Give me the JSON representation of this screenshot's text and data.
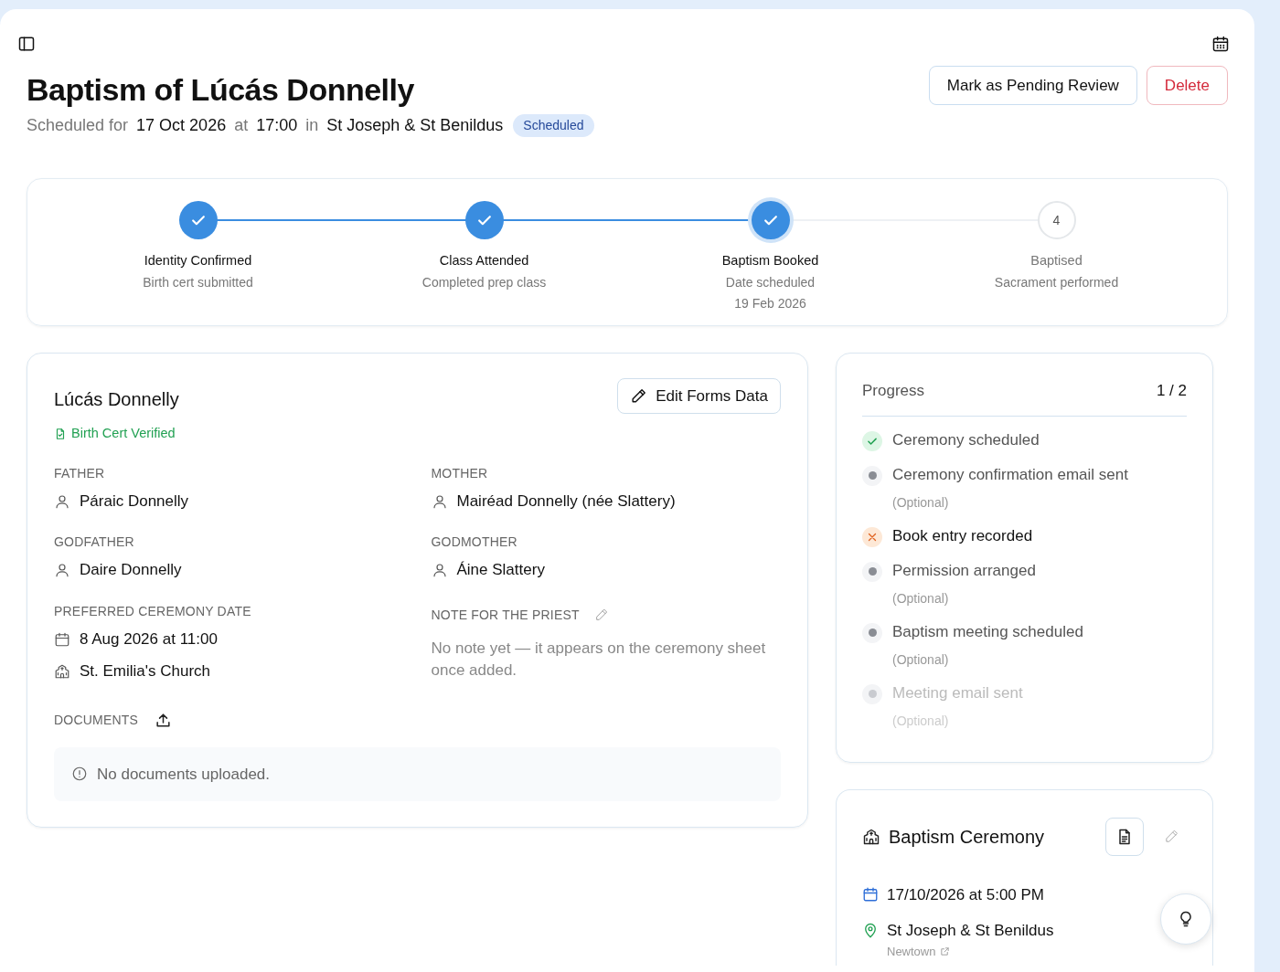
{
  "header": {
    "title": "Baptism of Lúcás Donnelly",
    "subtitle": [
      {
        "text": "Scheduled for",
        "emphasis": false
      },
      {
        "text": "17 Oct 2026",
        "emphasis": true
      },
      {
        "text": "at",
        "emphasis": false
      },
      {
        "text": "17:00",
        "emphasis": true
      },
      {
        "text": "in",
        "emphasis": false
      },
      {
        "text": "St Joseph & St Benildus",
        "emphasis": true
      }
    ],
    "status_badge": "Scheduled"
  },
  "actions": [
    {
      "label": "Mark as Pending Review",
      "kind": "neutral"
    },
    {
      "label": "Delete",
      "kind": "danger"
    }
  ],
  "stepper": [
    {
      "title": "Identity Confirmed",
      "lines": [
        "Birth cert submitted"
      ],
      "kind": "done",
      "current": false
    },
    {
      "title": "Class Attended",
      "lines": [
        "Completed prep class"
      ],
      "kind": "done",
      "current": false
    },
    {
      "title": "Baptism Booked",
      "lines": [
        "Date scheduled",
        "19 Feb 2026"
      ],
      "kind": "done",
      "current": true
    },
    {
      "title": "Baptised",
      "lines": [
        "Sacrament performed"
      ],
      "kind": "upcoming",
      "current": false,
      "number": "4"
    }
  ],
  "candidate": {
    "name": "Lúcás Donnelly",
    "verification": "Birth Cert Verified",
    "edit_button": "Edit Forms Data",
    "fields": [
      {
        "label": "FATHER",
        "values": [
          {
            "kind": "person",
            "text": "Páraic Donnelly"
          }
        ]
      },
      {
        "label": "MOTHER",
        "values": [
          {
            "kind": "person",
            "text": "Mairéad Donnelly (née Slattery)"
          }
        ]
      },
      {
        "label": "GODFATHER",
        "values": [
          {
            "kind": "person",
            "text": "Daire Donnelly"
          }
        ]
      },
      {
        "label": "GODMOTHER",
        "values": [
          {
            "kind": "person",
            "text": "Áine Slattery"
          }
        ]
      },
      {
        "label": "PREFERRED CEREMONY DATE",
        "values": [
          {
            "kind": "date",
            "text": "8 Aug 2026 at 11:00"
          },
          {
            "kind": "church",
            "text": "St. Emilia's Church"
          }
        ]
      }
    ],
    "note": {
      "label": "NOTE FOR THE PRIEST",
      "text": "No note yet — it appears on the ceremony sheet once added."
    },
    "documents": {
      "label": "DOCUMENTS",
      "empty": "No documents uploaded."
    }
  },
  "progress": {
    "title": "Progress",
    "count": "1 / 2",
    "items": [
      {
        "label": "Ceremony scheduled",
        "kind": "done",
        "disabled": false
      },
      {
        "label": "Ceremony confirmation email sent",
        "kind": "pending",
        "note": "(Optional)",
        "disabled": false
      },
      {
        "label": "Book entry recorded",
        "kind": "missing",
        "disabled": false
      },
      {
        "label": "Permission arranged",
        "kind": "pending",
        "note": "(Optional)",
        "disabled": false
      },
      {
        "label": "Baptism meeting scheduled",
        "kind": "pending",
        "note": "(Optional)",
        "disabled": false
      },
      {
        "label": "Meeting email sent",
        "kind": "pending",
        "note": "(Optional)",
        "disabled": true
      }
    ]
  },
  "ceremony": {
    "title": "Baptism Ceremony",
    "datetime": "17/10/2026 at 5:00 PM",
    "venue": "St Joseph & St Benildus",
    "area": "Newtown"
  }
}
